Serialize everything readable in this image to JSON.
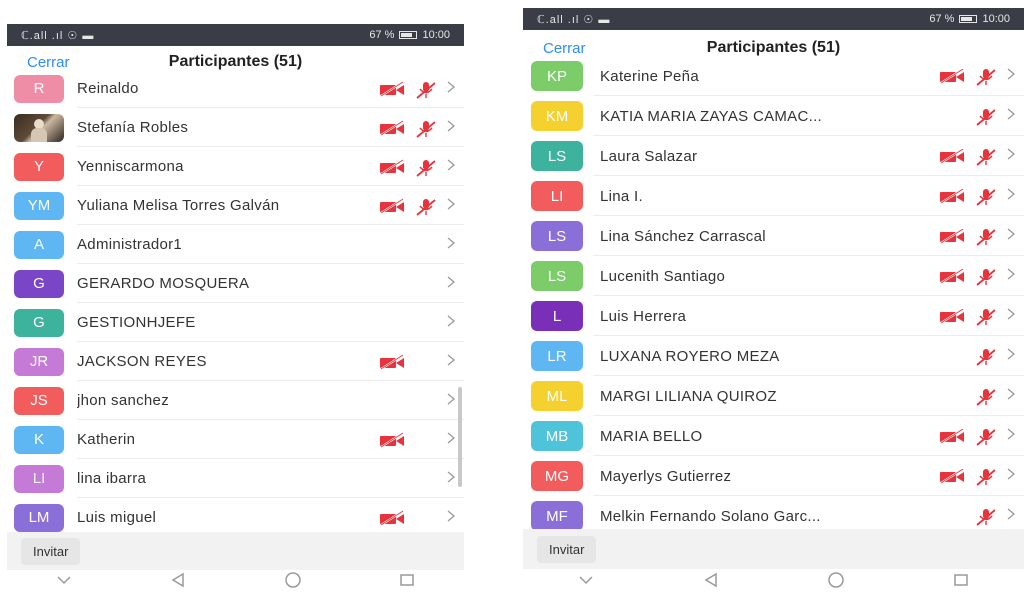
{
  "left": {
    "status": {
      "signal": "ℂ.all  .ıl ☉ ▬",
      "battery": "67 %",
      "time": "10:00"
    },
    "header": {
      "close": "Cerrar",
      "title": "Participantes (51)"
    },
    "participants": [
      {
        "initials": "R",
        "name": "Reinaldo",
        "color": "#f08da6",
        "video_off": true,
        "muted": true,
        "photo": false
      },
      {
        "initials": "",
        "name": "Stefanía Robles",
        "color": "#3a2c22",
        "video_off": true,
        "muted": true,
        "photo": true
      },
      {
        "initials": "Y",
        "name": "Yenniscarmona",
        "color": "#f25c5c",
        "video_off": true,
        "muted": true,
        "photo": false
      },
      {
        "initials": "YM",
        "name": "Yuliana Melisa Torres Galván",
        "color": "#5eb6f2",
        "video_off": true,
        "muted": true,
        "photo": false
      },
      {
        "initials": "A",
        "name": "Administrador1",
        "color": "#5eb6f2",
        "video_off": false,
        "muted": false,
        "photo": false
      },
      {
        "initials": "G",
        "name": "GERARDO MOSQUERA",
        "color": "#7a45c6",
        "video_off": false,
        "muted": false,
        "photo": false
      },
      {
        "initials": "G",
        "name": "GESTIONHJEFE",
        "color": "#3db39e",
        "video_off": false,
        "muted": false,
        "photo": false
      },
      {
        "initials": "JR",
        "name": "JACKSON REYES",
        "color": "#c47ad6",
        "video_off": true,
        "muted": false,
        "photo": false
      },
      {
        "initials": "JS",
        "name": "jhon sanchez",
        "color": "#f25c5c",
        "video_off": false,
        "muted": false,
        "photo": false
      },
      {
        "initials": "K",
        "name": "Katherin",
        "color": "#5eb6f2",
        "video_off": true,
        "muted": false,
        "photo": false
      },
      {
        "initials": "LI",
        "name": "lina ibarra",
        "color": "#c47ad6",
        "video_off": false,
        "muted": false,
        "photo": false
      },
      {
        "initials": "LM",
        "name": "Luis miguel",
        "color": "#8a6fd9",
        "video_off": true,
        "muted": false,
        "photo": false
      }
    ],
    "footer": {
      "invite": "Invitar"
    }
  },
  "right": {
    "status": {
      "signal": "ℂ.all  .ıl ☉ ▬",
      "battery": "67 %",
      "time": "10:00"
    },
    "header": {
      "close": "Cerrar",
      "title": "Participantes (51)"
    },
    "participants": [
      {
        "initials": "KP",
        "name": "Katerine Peña",
        "color": "#7ccc6a",
        "video_off": true,
        "muted": true
      },
      {
        "initials": "KM",
        "name": "KATIA MARIA ZAYAS CAMAC...",
        "color": "#f5d12f",
        "video_off": false,
        "muted": true
      },
      {
        "initials": "LS",
        "name": "Laura Salazar",
        "color": "#3db39e",
        "video_off": true,
        "muted": true
      },
      {
        "initials": "LI",
        "name": "Lina I.",
        "color": "#f25c5c",
        "video_off": true,
        "muted": true
      },
      {
        "initials": "LS",
        "name": "Lina Sánchez Carrascal",
        "color": "#8a6fd9",
        "video_off": true,
        "muted": true
      },
      {
        "initials": "LS",
        "name": "Lucenith Santiago",
        "color": "#7ccc6a",
        "video_off": true,
        "muted": true
      },
      {
        "initials": "L",
        "name": "Luis Herrera",
        "color": "#7a2fb8",
        "video_off": true,
        "muted": true
      },
      {
        "initials": "LR",
        "name": "LUXANA ROYERO MEZA",
        "color": "#5eb6f2",
        "video_off": false,
        "muted": true
      },
      {
        "initials": "ML",
        "name": "MARGI LILIANA QUIROZ",
        "color": "#f5d12f",
        "video_off": false,
        "muted": true
      },
      {
        "initials": "MB",
        "name": "MARIA BELLO",
        "color": "#4fc3d9",
        "video_off": true,
        "muted": true
      },
      {
        "initials": "MG",
        "name": "Mayerlys Gutierrez",
        "color": "#f25c5c",
        "video_off": true,
        "muted": true
      },
      {
        "initials": "MF",
        "name": "Melkin Fernando Solano Garc...",
        "color": "#8a6fd9",
        "video_off": false,
        "muted": true
      }
    ],
    "footer": {
      "invite": "Invitar"
    }
  },
  "theme": {
    "accent": "#2d8cff",
    "alert": "#e8323c",
    "statusbar": "#3a3d46"
  },
  "icons": {
    "video_off": "video-off-icon",
    "muted": "mic-muted-icon",
    "chevron": "chevron-right-icon"
  }
}
